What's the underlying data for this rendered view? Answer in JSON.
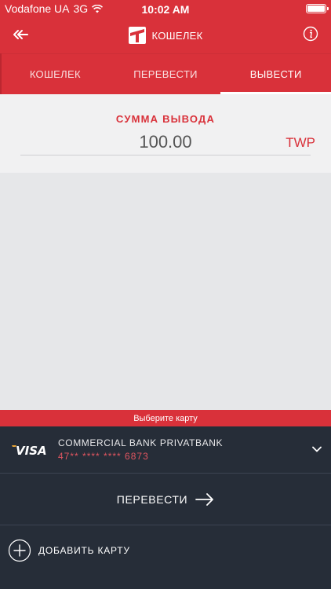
{
  "status": {
    "carrier": "Vodafone UA",
    "network": "3G",
    "time": "10:02 AM"
  },
  "header": {
    "title": "КОШЕЛЕК"
  },
  "tabs": [
    {
      "label": "КОШЕЛЕК",
      "active": false
    },
    {
      "label": "ПЕРЕВЕСТИ",
      "active": false
    },
    {
      "label": "ВЫВЕСТИ",
      "active": true
    }
  ],
  "amount": {
    "label": "СУММА ВЫВОДА",
    "value": "100.00",
    "currency": "TWP"
  },
  "choose_card": "Выберите карту",
  "card": {
    "brand": "VISA",
    "bank": "COMMERCIAL BANK PRIVATBANK",
    "number": "47** **** **** 6873"
  },
  "transfer_button": "ПЕРЕВЕСТИ",
  "add_card": "ДОБАВИТЬ КАРТУ",
  "colors": {
    "accent": "#d9313a",
    "dark": "#262d38",
    "panel": "#f1f1f2",
    "background": "#e6e7e9"
  }
}
